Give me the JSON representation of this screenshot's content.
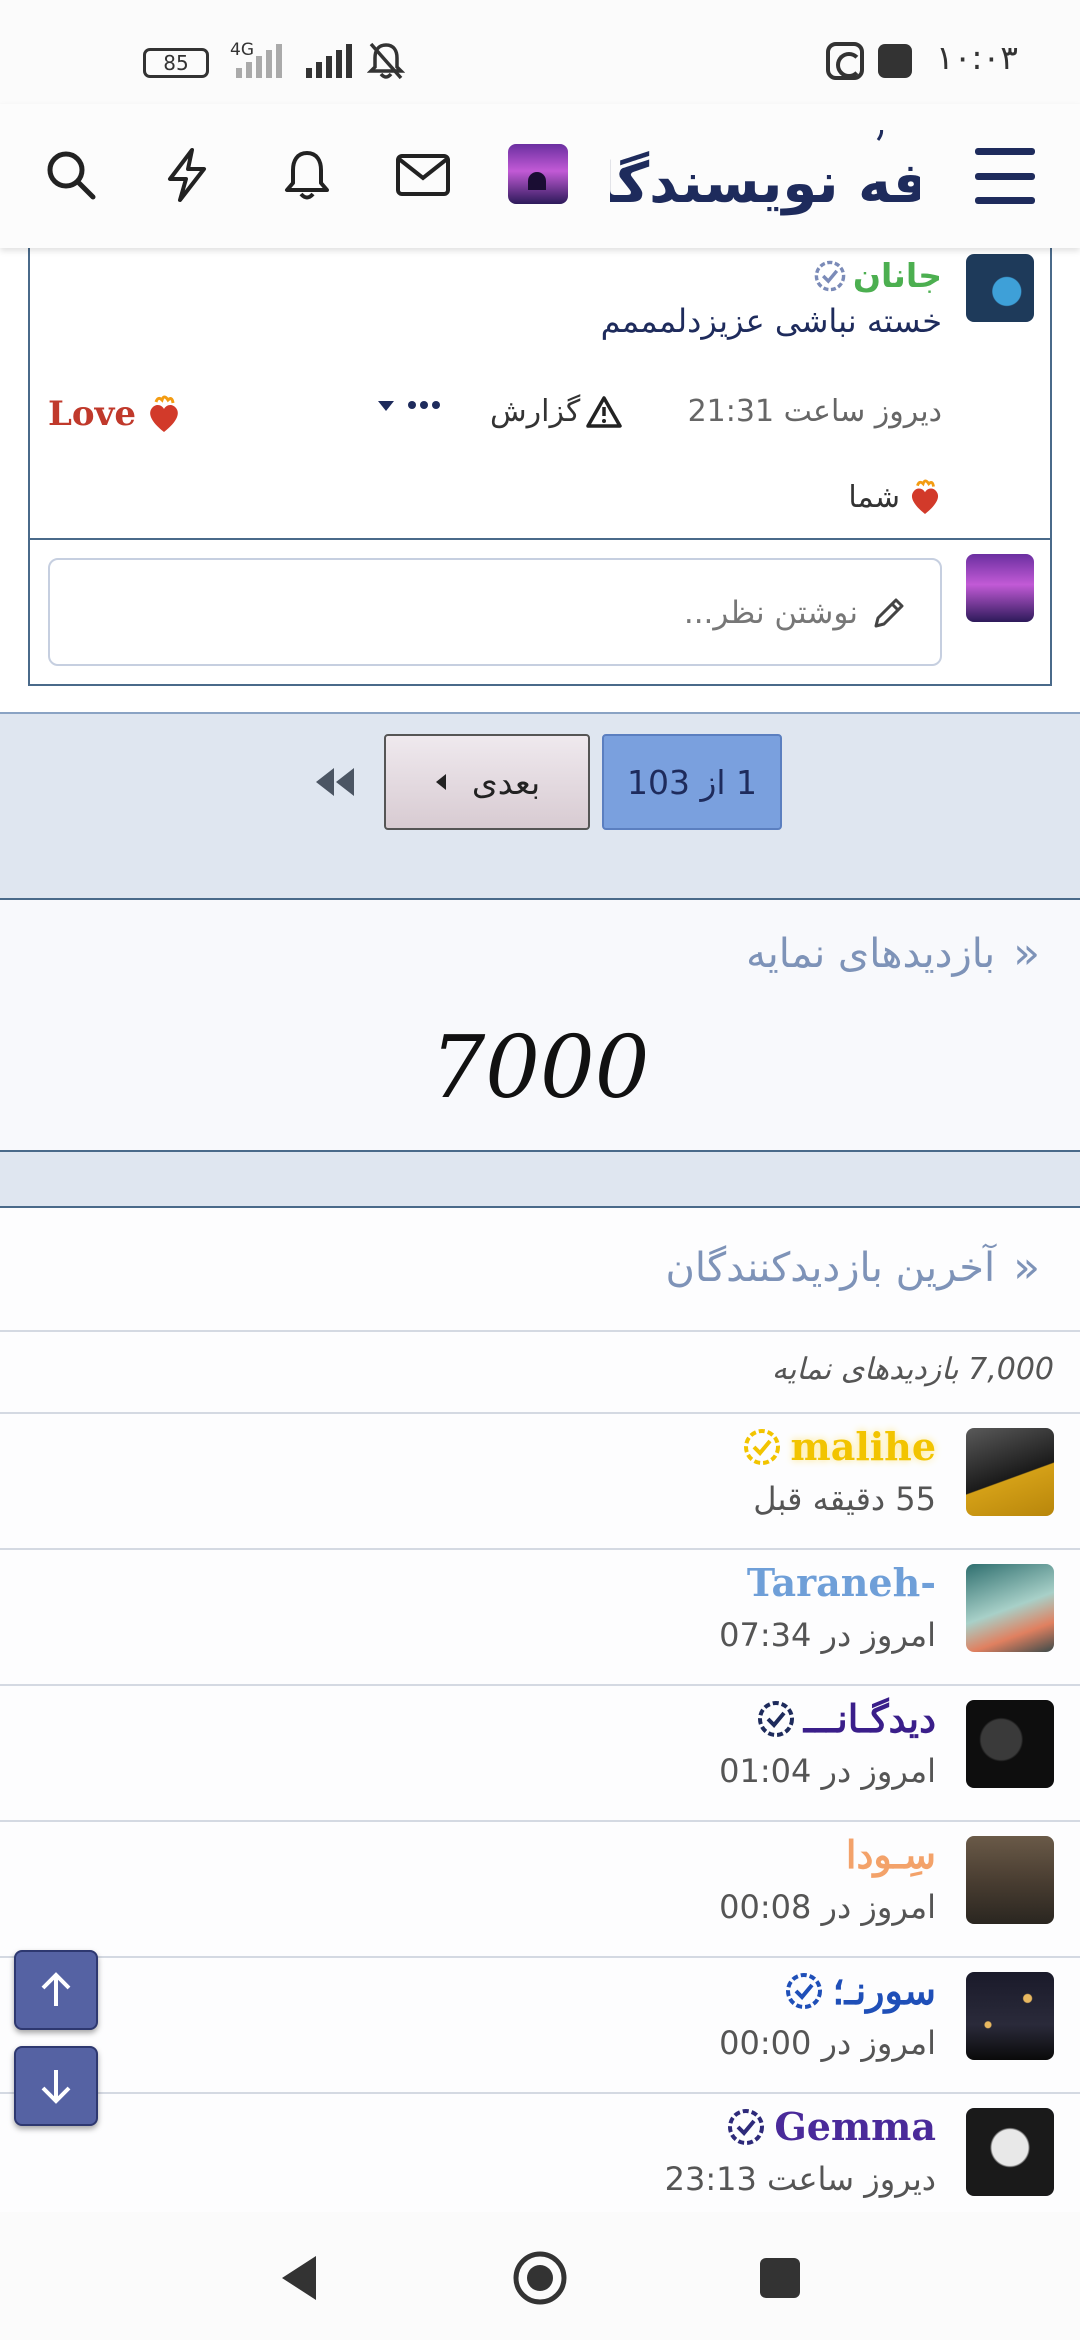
{
  "status_bar": {
    "time": "۱۰:۰۳",
    "battery": "85",
    "network": "4G"
  },
  "header": {
    "logo_text": "کافه نویسندگان",
    "icons": [
      "search-icon",
      "lightning-icon",
      "bell-icon",
      "mail-icon",
      "avatar",
      "menu-icon"
    ]
  },
  "comment": {
    "author": "جانان",
    "text": "خسته نباشی عزیزدلمممم",
    "timestamp": "دیروز ساعت 21:31",
    "report_label": "گزارش",
    "reaction_label": "Love",
    "reactor": "شما",
    "reply_placeholder": "نوشتن نظر..."
  },
  "pagination": {
    "current": "1 از 103",
    "next_label": "بعدی"
  },
  "profile_views": {
    "title": "بازدیدهای نمایه",
    "count": "7000"
  },
  "last_visitors": {
    "title": "آخرین بازدیدکنندگان",
    "summary": "7,000 بازدیدهای نمایه",
    "rows": [
      {
        "name": "malihe",
        "time": "55 دقیقه قبل",
        "color": "#f2c400",
        "verified": true
      },
      {
        "name": "-Taraneh",
        "time": "امروز در 07:34",
        "color": "#6f9fd8",
        "verified": false
      },
      {
        "name": "دیدگـانـــ",
        "time": "امروز در 01:04",
        "color": "#3a1e8a",
        "verified": true
      },
      {
        "name": "سِـودا",
        "time": "امروز در 00:08",
        "color": "#f3a26a",
        "verified": false
      },
      {
        "name": "سورنـ؛",
        "time": "امروز در 00:00",
        "color": "#1f4fb8",
        "verified": true
      },
      {
        "name": "Gemma",
        "time": "دیروز ساعت 23:13",
        "color": "#4a2a9a",
        "verified": true
      }
    ]
  },
  "colors": {
    "brand_navy": "#1e2b5c",
    "pager_active": "#7aa0de",
    "section_title": "#7e93b8",
    "fab": "#5562a3"
  }
}
